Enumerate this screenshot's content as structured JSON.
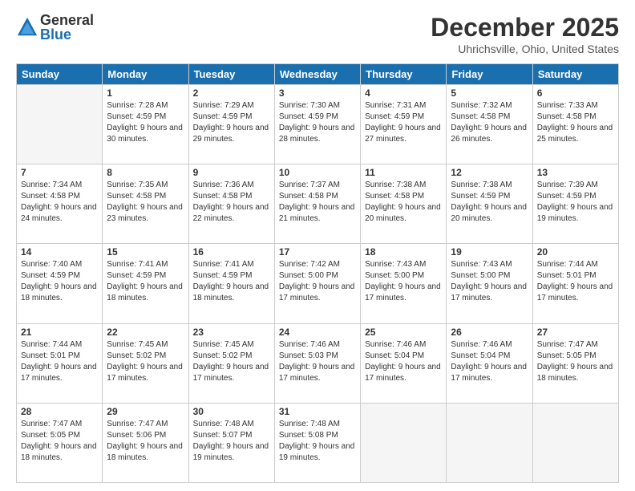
{
  "logo": {
    "general": "General",
    "blue": "Blue"
  },
  "header": {
    "month": "December 2025",
    "location": "Uhrichsville, Ohio, United States"
  },
  "days": [
    "Sunday",
    "Monday",
    "Tuesday",
    "Wednesday",
    "Thursday",
    "Friday",
    "Saturday"
  ],
  "weeks": [
    [
      {
        "day": "",
        "empty": true
      },
      {
        "day": "1",
        "sunrise": "Sunrise: 7:28 AM",
        "sunset": "Sunset: 4:59 PM",
        "daylight": "Daylight: 9 hours and 30 minutes."
      },
      {
        "day": "2",
        "sunrise": "Sunrise: 7:29 AM",
        "sunset": "Sunset: 4:59 PM",
        "daylight": "Daylight: 9 hours and 29 minutes."
      },
      {
        "day": "3",
        "sunrise": "Sunrise: 7:30 AM",
        "sunset": "Sunset: 4:59 PM",
        "daylight": "Daylight: 9 hours and 28 minutes."
      },
      {
        "day": "4",
        "sunrise": "Sunrise: 7:31 AM",
        "sunset": "Sunset: 4:59 PM",
        "daylight": "Daylight: 9 hours and 27 minutes."
      },
      {
        "day": "5",
        "sunrise": "Sunrise: 7:32 AM",
        "sunset": "Sunset: 4:58 PM",
        "daylight": "Daylight: 9 hours and 26 minutes."
      },
      {
        "day": "6",
        "sunrise": "Sunrise: 7:33 AM",
        "sunset": "Sunset: 4:58 PM",
        "daylight": "Daylight: 9 hours and 25 minutes."
      }
    ],
    [
      {
        "day": "7",
        "sunrise": "Sunrise: 7:34 AM",
        "sunset": "Sunset: 4:58 PM",
        "daylight": "Daylight: 9 hours and 24 minutes."
      },
      {
        "day": "8",
        "sunrise": "Sunrise: 7:35 AM",
        "sunset": "Sunset: 4:58 PM",
        "daylight": "Daylight: 9 hours and 23 minutes."
      },
      {
        "day": "9",
        "sunrise": "Sunrise: 7:36 AM",
        "sunset": "Sunset: 4:58 PM",
        "daylight": "Daylight: 9 hours and 22 minutes."
      },
      {
        "day": "10",
        "sunrise": "Sunrise: 7:37 AM",
        "sunset": "Sunset: 4:58 PM",
        "daylight": "Daylight: 9 hours and 21 minutes."
      },
      {
        "day": "11",
        "sunrise": "Sunrise: 7:38 AM",
        "sunset": "Sunset: 4:58 PM",
        "daylight": "Daylight: 9 hours and 20 minutes."
      },
      {
        "day": "12",
        "sunrise": "Sunrise: 7:38 AM",
        "sunset": "Sunset: 4:59 PM",
        "daylight": "Daylight: 9 hours and 20 minutes."
      },
      {
        "day": "13",
        "sunrise": "Sunrise: 7:39 AM",
        "sunset": "Sunset: 4:59 PM",
        "daylight": "Daylight: 9 hours and 19 minutes."
      }
    ],
    [
      {
        "day": "14",
        "sunrise": "Sunrise: 7:40 AM",
        "sunset": "Sunset: 4:59 PM",
        "daylight": "Daylight: 9 hours and 18 minutes."
      },
      {
        "day": "15",
        "sunrise": "Sunrise: 7:41 AM",
        "sunset": "Sunset: 4:59 PM",
        "daylight": "Daylight: 9 hours and 18 minutes."
      },
      {
        "day": "16",
        "sunrise": "Sunrise: 7:41 AM",
        "sunset": "Sunset: 4:59 PM",
        "daylight": "Daylight: 9 hours and 18 minutes."
      },
      {
        "day": "17",
        "sunrise": "Sunrise: 7:42 AM",
        "sunset": "Sunset: 5:00 PM",
        "daylight": "Daylight: 9 hours and 17 minutes."
      },
      {
        "day": "18",
        "sunrise": "Sunrise: 7:43 AM",
        "sunset": "Sunset: 5:00 PM",
        "daylight": "Daylight: 9 hours and 17 minutes."
      },
      {
        "day": "19",
        "sunrise": "Sunrise: 7:43 AM",
        "sunset": "Sunset: 5:00 PM",
        "daylight": "Daylight: 9 hours and 17 minutes."
      },
      {
        "day": "20",
        "sunrise": "Sunrise: 7:44 AM",
        "sunset": "Sunset: 5:01 PM",
        "daylight": "Daylight: 9 hours and 17 minutes."
      }
    ],
    [
      {
        "day": "21",
        "sunrise": "Sunrise: 7:44 AM",
        "sunset": "Sunset: 5:01 PM",
        "daylight": "Daylight: 9 hours and 17 minutes."
      },
      {
        "day": "22",
        "sunrise": "Sunrise: 7:45 AM",
        "sunset": "Sunset: 5:02 PM",
        "daylight": "Daylight: 9 hours and 17 minutes."
      },
      {
        "day": "23",
        "sunrise": "Sunrise: 7:45 AM",
        "sunset": "Sunset: 5:02 PM",
        "daylight": "Daylight: 9 hours and 17 minutes."
      },
      {
        "day": "24",
        "sunrise": "Sunrise: 7:46 AM",
        "sunset": "Sunset: 5:03 PM",
        "daylight": "Daylight: 9 hours and 17 minutes."
      },
      {
        "day": "25",
        "sunrise": "Sunrise: 7:46 AM",
        "sunset": "Sunset: 5:04 PM",
        "daylight": "Daylight: 9 hours and 17 minutes."
      },
      {
        "day": "26",
        "sunrise": "Sunrise: 7:46 AM",
        "sunset": "Sunset: 5:04 PM",
        "daylight": "Daylight: 9 hours and 17 minutes."
      },
      {
        "day": "27",
        "sunrise": "Sunrise: 7:47 AM",
        "sunset": "Sunset: 5:05 PM",
        "daylight": "Daylight: 9 hours and 18 minutes."
      }
    ],
    [
      {
        "day": "28",
        "sunrise": "Sunrise: 7:47 AM",
        "sunset": "Sunset: 5:05 PM",
        "daylight": "Daylight: 9 hours and 18 minutes."
      },
      {
        "day": "29",
        "sunrise": "Sunrise: 7:47 AM",
        "sunset": "Sunset: 5:06 PM",
        "daylight": "Daylight: 9 hours and 18 minutes."
      },
      {
        "day": "30",
        "sunrise": "Sunrise: 7:48 AM",
        "sunset": "Sunset: 5:07 PM",
        "daylight": "Daylight: 9 hours and 19 minutes."
      },
      {
        "day": "31",
        "sunrise": "Sunrise: 7:48 AM",
        "sunset": "Sunset: 5:08 PM",
        "daylight": "Daylight: 9 hours and 19 minutes."
      },
      {
        "day": "",
        "empty": true
      },
      {
        "day": "",
        "empty": true
      },
      {
        "day": "",
        "empty": true
      }
    ]
  ]
}
